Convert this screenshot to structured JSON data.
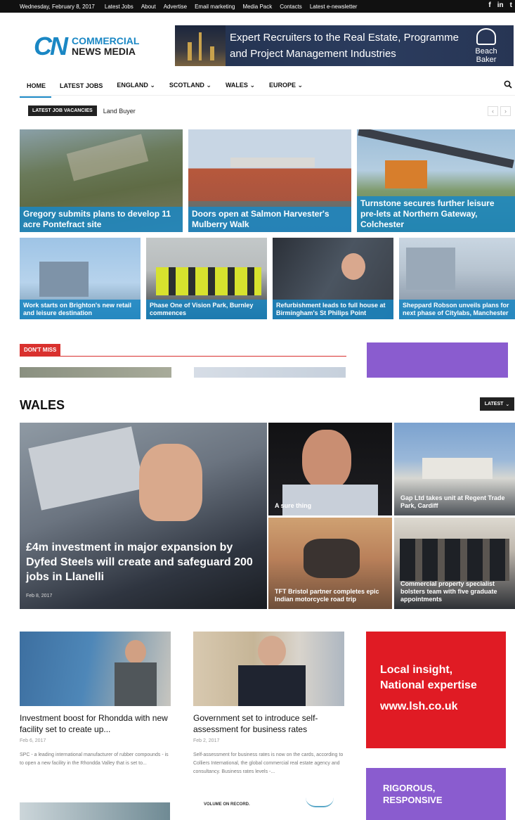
{
  "topbar": {
    "date": "Wednesday, February 8, 2017",
    "links": [
      "Latest Jobs",
      "About",
      "Advertise",
      "Email marketing",
      "Media Pack",
      "Contacts",
      "Latest e-newsletter"
    ],
    "social": [
      "f",
      "in",
      "t"
    ]
  },
  "header": {
    "logo_mark": "CN",
    "logo_line1": "COMMERCIAL",
    "logo_line2": "NEWS MEDIA",
    "banner_line1": "Expert Recruiters to the Real Estate, Programme",
    "banner_line2": "and Project Management Industries",
    "banner_brand": "Beach Baker"
  },
  "nav": {
    "items": [
      "HOME",
      "LATEST JOBS",
      "ENGLAND ⌄",
      "SCOTLAND ⌄",
      "WALES ⌄",
      "EUROPE ⌄"
    ],
    "accent": "#1a87c4"
  },
  "ticker": {
    "tag": "LATEST JOB VACANCIES",
    "text": "Land Buyer",
    "prev": "‹",
    "next": "›"
  },
  "featured": [
    {
      "caption": "Gregory submits plans to develop 11 acre Pontefract site"
    },
    {
      "caption": "Doors open at Salmon Harvester's Mulberry Walk"
    },
    {
      "caption": "Turnstone secures further leisure pre-lets at Northern Gateway, Colchester"
    },
    {
      "caption": "Work starts on Brighton's new retail and leisure destination"
    },
    {
      "caption": "Phase One of Vision Park, Burnley commences"
    },
    {
      "caption": "Refurbishment leads to full house at Birmingham's St Philips Point"
    },
    {
      "caption": "Sheppard Robson unveils plans for next phase of Citylabs, Manchester"
    }
  ],
  "dont_miss": {
    "tag": "DON'T MISS"
  },
  "wales": {
    "heading": "WALES",
    "latest_btn": "LATEST",
    "tiles": [
      {
        "caption": "£4m investment in major expansion by Dyfed Steels will create and safeguard 200 jobs in Llanelli",
        "date": "Feb 8, 2017"
      },
      {
        "caption": "A sure thing"
      },
      {
        "caption": "Gap Ltd takes unit at Regent Trade Park, Cardiff"
      },
      {
        "caption": "TFT Bristol partner completes epic Indian motorcycle road trip"
      },
      {
        "caption": "Commercial property specialist bolsters team with five graduate appointments"
      }
    ]
  },
  "articles": [
    {
      "title": "Investment boost for Rhondda with new facility set to create up...",
      "date": "Feb 6, 2017",
      "excerpt": "SPC - a leading international manufacturer of rubber compounds - is to open a new facility in the Rhondda Valley that is set to..."
    },
    {
      "title": "Government set to introduce self-assessment for business rates",
      "date": "Feb 2, 2017",
      "excerpt": "Self-assessment for business rates is now on the cards, according to Colliers International, the global commercial real estate agency and consultancy. Business rates levels -..."
    }
  ],
  "ads": {
    "lsh_line1": "Local insight,",
    "lsh_line2": "National expertise",
    "lsh_url": "www.lsh.co.uk",
    "rig_line1": "RIGOROUS,",
    "rig_line2": "RESPONSIVE",
    "volume_text": "VOLUME ON RECORD."
  }
}
